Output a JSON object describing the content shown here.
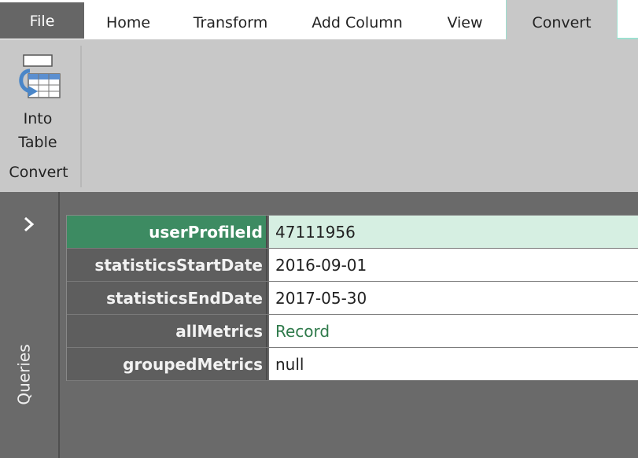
{
  "tabs": {
    "file": "File",
    "home": "Home",
    "transform": "Transform",
    "add_column": "Add Column",
    "view": "View",
    "convert": "Convert"
  },
  "ribbon": {
    "into_table_line1": "Into",
    "into_table_line2": "Table",
    "group_label": "Convert",
    "icon": "into-table-icon"
  },
  "queries_pane": {
    "label": "Queries",
    "expand_icon": "chevron-right-icon"
  },
  "record": {
    "rows": [
      {
        "key": "userProfileId",
        "value": "47111956"
      },
      {
        "key": "statisticsStartDate",
        "value": "2016-09-01"
      },
      {
        "key": "statisticsEndDate",
        "value": "2017-05-30"
      },
      {
        "key": "allMetrics",
        "value": "Record"
      },
      {
        "key": "groupedMetrics",
        "value": "null"
      }
    ]
  },
  "colors": {
    "accent_green": "#3d8b62",
    "selected_row_bg": "#d6efe2",
    "link_green": "#2f7a4b",
    "tab_outline": "#9de0d0"
  }
}
